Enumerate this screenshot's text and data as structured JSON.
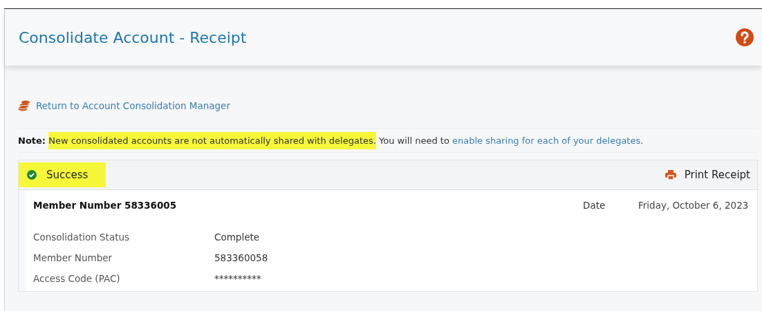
{
  "header": {
    "title": "Consolidate Account - Receipt"
  },
  "return_link": "Return to Account Consolidation Manager",
  "note": {
    "label": "Note:",
    "parts": [
      {
        "kind": "text",
        "text": "New consolidated accounts are not automatically shared with delegates.",
        "highlighted": true
      },
      {
        "kind": "text",
        "text": " You will need to ",
        "highlighted": false
      },
      {
        "kind": "link",
        "text": "enable sharing for each of your delegates",
        "highlighted": false
      },
      {
        "kind": "text",
        "text": ".",
        "highlighted": false
      }
    ]
  },
  "status": {
    "label": "Success",
    "highlighted": true
  },
  "print_button": "Print Receipt",
  "receipt": {
    "title": "Member Number 58336005",
    "date_label": "Date",
    "date": "Friday, October 6, 2023",
    "fields": [
      {
        "label": "Consolidation Status",
        "value": "Complete"
      },
      {
        "label": "Member Number",
        "value": "583360058"
      },
      {
        "label": "Access Code (PAC)",
        "value": "**********"
      }
    ]
  }
}
